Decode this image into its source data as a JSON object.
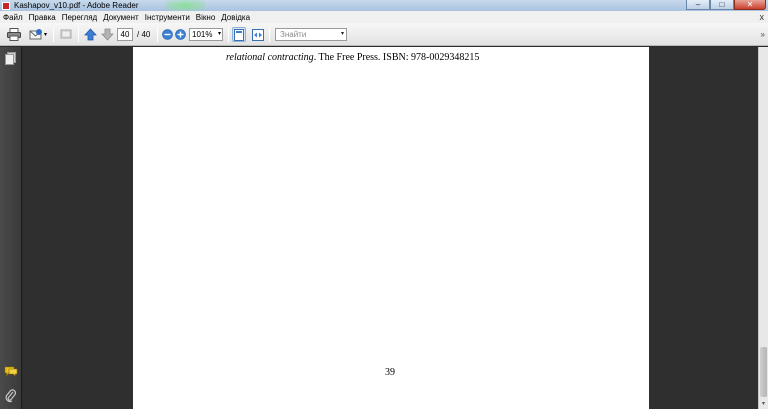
{
  "window": {
    "title": "Kashapov_v10.pdf - Adobe Reader",
    "minimize": "–",
    "maximize": "□",
    "close": "✕"
  },
  "menu": {
    "items": [
      "Файл",
      "Правка",
      "Перегляд",
      "Документ",
      "Інструменти",
      "Вікно",
      "Довідка"
    ],
    "close_glyph": "x"
  },
  "toolbar": {
    "current_page": "40",
    "page_total": "/ 40",
    "zoom": "101%",
    "find_placeholder": "Знайти",
    "dropdown_glyph": "▾",
    "expand_glyph": "»"
  },
  "document": {
    "ref_italic": "relational contracting",
    "ref_rest": ". The Free Press. ISBN: 978-0029348215",
    "page_number": "39"
  },
  "colors": {
    "accent_blue": "#2f6fc0",
    "adobe_red": "#c62828",
    "sticky_note_yellow": "#e8c020"
  },
  "icons": {
    "print": "printer-icon",
    "email": "email-icon",
    "comment": "comment-icon",
    "prev": "arrow-up-icon",
    "next": "arrow-down-icon",
    "zoom_out": "zoom-out-icon",
    "zoom_in": "zoom-in-icon",
    "fit_page": "fit-page-icon",
    "fit_width": "fit-width-icon",
    "pages_panel": "pages-panel-icon",
    "comments_panel": "comments-panel-icon",
    "attachments_panel": "paperclip-icon"
  }
}
